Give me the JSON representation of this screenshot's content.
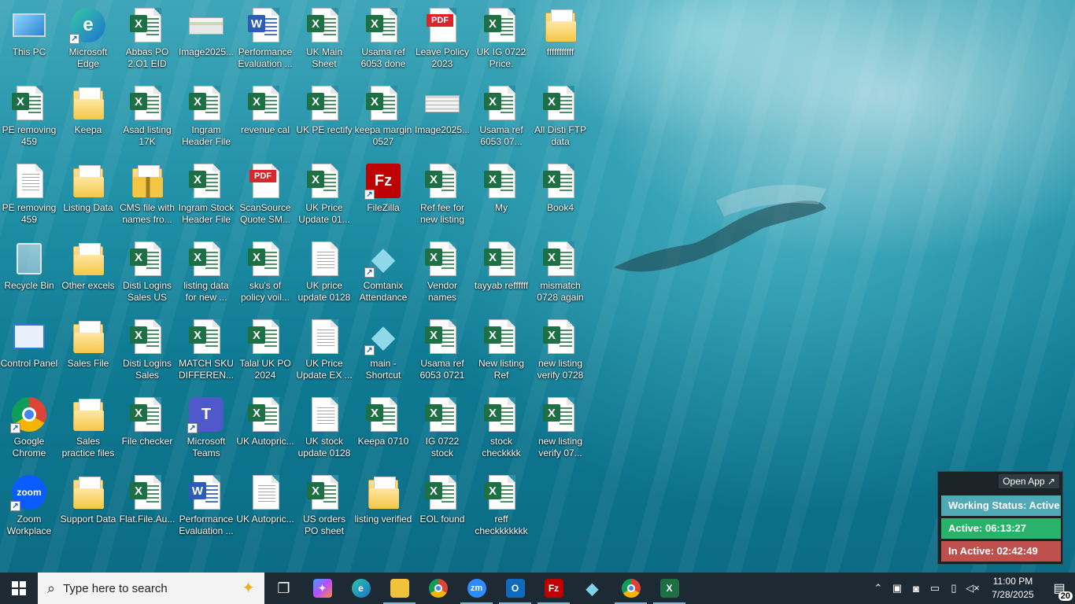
{
  "desktop": {
    "icons": [
      {
        "label": "This PC",
        "type": "pc"
      },
      {
        "label": "Microsoft Edge",
        "type": "edge"
      },
      {
        "label": "Abbas PO 2.O1 EID",
        "type": "excel"
      },
      {
        "label": "Image2025...",
        "type": "image"
      },
      {
        "label": "Performance Evaluation ...",
        "type": "word"
      },
      {
        "label": "UK Main Sheet",
        "type": "excel"
      },
      {
        "label": "Usama ref 6053 done",
        "type": "excel"
      },
      {
        "label": "Leave Policy 2023",
        "type": "pdf"
      },
      {
        "label": "UK IG 0722 Price.",
        "type": "excel"
      },
      {
        "label": "fffffffffff",
        "type": "folder"
      },
      {
        "label": "PE removing 459",
        "type": "excel"
      },
      {
        "label": "Keepa",
        "type": "folder"
      },
      {
        "label": "Asad listing 17K",
        "type": "excel"
      },
      {
        "label": "Ingram Header File",
        "type": "excel"
      },
      {
        "label": "revenue cal",
        "type": "excel"
      },
      {
        "label": "UK PE rectify",
        "type": "excel"
      },
      {
        "label": "keepa margin 0527",
        "type": "excel"
      },
      {
        "label": "Image2025...",
        "type": "image2"
      },
      {
        "label": "Usama ref 6053 07...",
        "type": "excel"
      },
      {
        "label": "All Disti FTP data",
        "type": "excel"
      },
      {
        "label": "PE removing 459",
        "type": "text"
      },
      {
        "label": "Listing Data",
        "type": "folder"
      },
      {
        "label": "CMS file with names fro...",
        "type": "zip"
      },
      {
        "label": "Ingram Stock Header File",
        "type": "excel"
      },
      {
        "label": "ScanSource Quote SM...",
        "type": "pdf"
      },
      {
        "label": "UK Price Update 01...",
        "type": "excel"
      },
      {
        "label": "FileZilla",
        "type": "filezilla"
      },
      {
        "label": "Ref fee for new listing",
        "type": "excel"
      },
      {
        "label": "My",
        "type": "excel"
      },
      {
        "label": "Book4",
        "type": "excel"
      },
      {
        "label": "Recycle Bin",
        "type": "recycle"
      },
      {
        "label": "Other excels",
        "type": "folder"
      },
      {
        "label": "Disti Logins Sales US",
        "type": "excel"
      },
      {
        "label": "listing data for new ...",
        "type": "excel"
      },
      {
        "label": "sku's of policy voil...",
        "type": "excel"
      },
      {
        "label": "UK price update 0128",
        "type": "text"
      },
      {
        "label": "Comtanix Attendance",
        "type": "comtanix"
      },
      {
        "label": "Vendor names",
        "type": "excel"
      },
      {
        "label": "tayyab reffffff",
        "type": "excel"
      },
      {
        "label": "mismatch 0728 again",
        "type": "excel"
      },
      {
        "label": "Control Panel",
        "type": "control"
      },
      {
        "label": "Sales File",
        "type": "folder"
      },
      {
        "label": "Disti Logins Sales",
        "type": "excel"
      },
      {
        "label": "MATCH SKU DIFFEREN...",
        "type": "excel"
      },
      {
        "label": "Talal UK PO 2024",
        "type": "excel"
      },
      {
        "label": "UK Price Update EX ...",
        "type": "text"
      },
      {
        "label": "main - Shortcut",
        "type": "comtanix"
      },
      {
        "label": "Usama ref 6053 0721",
        "type": "excel"
      },
      {
        "label": "New listing Ref",
        "type": "excel"
      },
      {
        "label": "new listing verify 0728",
        "type": "excel"
      },
      {
        "label": "Google Chrome",
        "type": "chrome"
      },
      {
        "label": "Sales practice files",
        "type": "folder"
      },
      {
        "label": "File checker",
        "type": "excel"
      },
      {
        "label": "Microsoft Teams",
        "type": "teams"
      },
      {
        "label": "UK Autopric...",
        "type": "excel"
      },
      {
        "label": "UK stock update 0128",
        "type": "text"
      },
      {
        "label": "Keepa 0710",
        "type": "excel"
      },
      {
        "label": "IG 0722 stock",
        "type": "excel"
      },
      {
        "label": "stock checkkkk",
        "type": "excel"
      },
      {
        "label": "new listing verify 07...",
        "type": "excel"
      },
      {
        "label": "Zoom Workplace",
        "type": "zoom"
      },
      {
        "label": "Support Data",
        "type": "folder"
      },
      {
        "label": "Flat.File.Au...",
        "type": "excel"
      },
      {
        "label": "Performance Evaluation ...",
        "type": "word"
      },
      {
        "label": "UK Autopric...",
        "type": "text"
      },
      {
        "label": "US orders PO sheet",
        "type": "excel"
      },
      {
        "label": "listing verified",
        "type": "folder"
      },
      {
        "label": "EOL found",
        "type": "excel"
      },
      {
        "label": "reff checkkkkkkk",
        "type": "excel"
      }
    ]
  },
  "widget": {
    "open_app": "Open App ↗",
    "working_status": "Working Status: Active",
    "active": "Active: 06:13:27",
    "inactive": "In Active: 02:42:49",
    "colors": {
      "working": "#4fa9b6",
      "active": "#29b36a",
      "inactive": "#c0504d"
    }
  },
  "taskbar": {
    "search_placeholder": "Type here to search",
    "apps": [
      {
        "name": "task-view",
        "glyph": "❐"
      },
      {
        "name": "copilot",
        "glyph": "✦"
      },
      {
        "name": "edge",
        "glyph": "e"
      },
      {
        "name": "file-explorer",
        "glyph": "▬"
      },
      {
        "name": "chrome",
        "glyph": "●"
      },
      {
        "name": "zoom",
        "glyph": "zm"
      },
      {
        "name": "outlook",
        "glyph": "O"
      },
      {
        "name": "filezilla",
        "glyph": "Fz"
      },
      {
        "name": "comtanix",
        "glyph": "◆"
      },
      {
        "name": "chrome-profile",
        "glyph": "●"
      },
      {
        "name": "excel",
        "glyph": "X"
      }
    ],
    "clock_time": "11:00 PM",
    "clock_date": "7/28/2025",
    "notification_count": "20"
  }
}
